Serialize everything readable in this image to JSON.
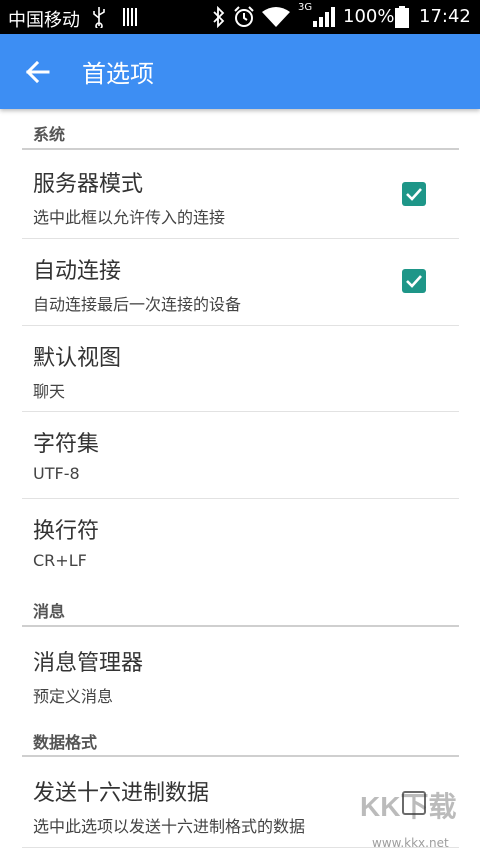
{
  "status_bar": {
    "carrier": "中国移动",
    "network": "3G",
    "battery_pct": "100%",
    "time": "17:42"
  },
  "app_bar": {
    "title": "首选项"
  },
  "sections": {
    "system": "系统",
    "messages": "消息",
    "data_format": "数据格式"
  },
  "prefs": {
    "server_mode": {
      "title": "服务器模式",
      "subtitle": "选中此框以允许传入的连接",
      "checked": true
    },
    "auto_connect": {
      "title": "自动连接",
      "subtitle": "自动连接最后一次连接的设备",
      "checked": true
    },
    "default_view": {
      "title": "默认视图",
      "subtitle": "聊天"
    },
    "charset": {
      "title": "字符集",
      "subtitle": "UTF-8"
    },
    "newline": {
      "title": "换行符",
      "subtitle": "CR+LF"
    },
    "message_manager": {
      "title": "消息管理器",
      "subtitle": "预定义消息"
    },
    "send_hex": {
      "title": "发送十六进制数据",
      "subtitle": "选中此选项以发送十六进制格式的数据",
      "checked": false
    }
  },
  "watermark": {
    "text": "KK下载",
    "url": "www.kkx.net"
  },
  "colors": {
    "app_bar": "#3d8ef3",
    "checkbox": "#1e9688"
  }
}
